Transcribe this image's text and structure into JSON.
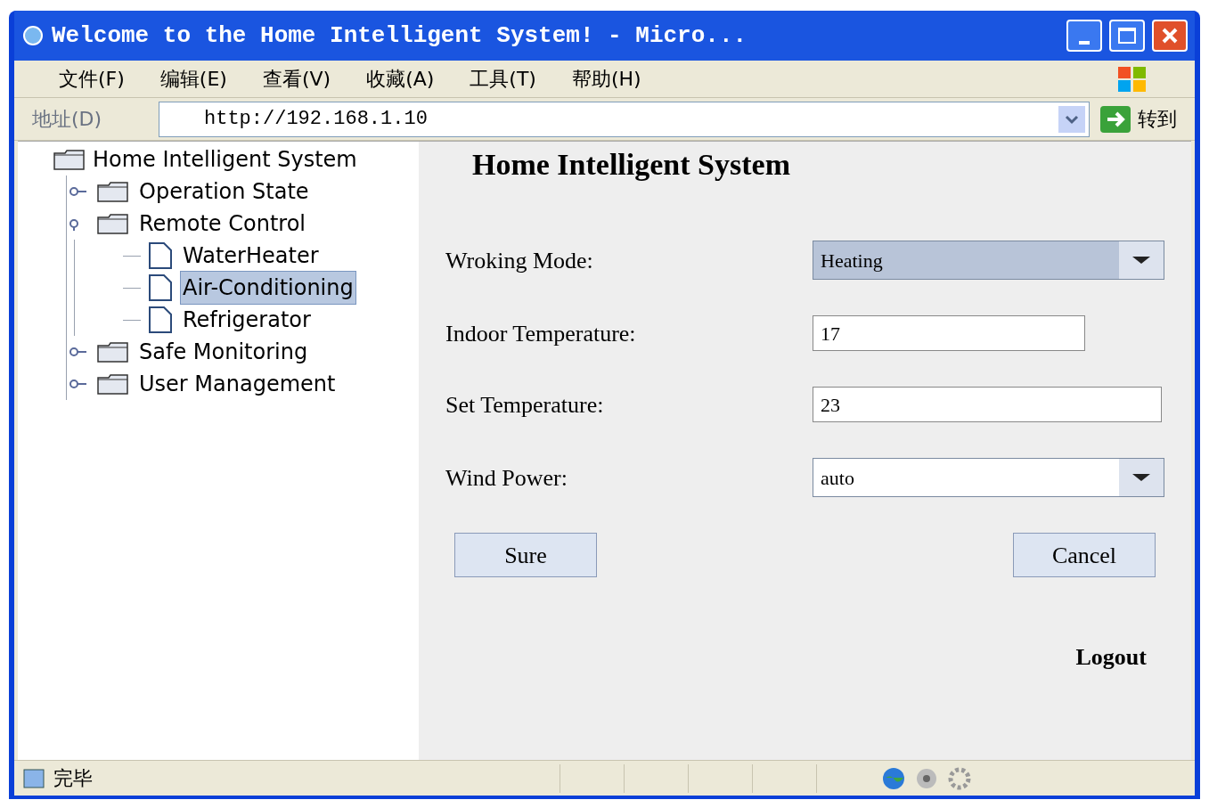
{
  "window": {
    "title": "Welcome to the Home Intelligent System! - Micro..."
  },
  "menu": [
    "文件(F)",
    "编辑(E)",
    "查看(V)",
    "收藏(A)",
    "工具(T)",
    "帮助(H)"
  ],
  "address_bar": {
    "label": "地址(D)",
    "value": "http://192.168.1.10",
    "go": "转到"
  },
  "tree": {
    "label": "Home Intelligent System",
    "children": [
      {
        "label": "Operation State",
        "kind": "folder",
        "expanded": false,
        "selected": false
      },
      {
        "label": "Remote Control",
        "kind": "folder",
        "expanded": true,
        "selected": false,
        "children": [
          {
            "label": "WaterHeater",
            "kind": "file",
            "selected": false
          },
          {
            "label": "Air-Conditioning",
            "kind": "file",
            "selected": true
          },
          {
            "label": "Refrigerator",
            "kind": "file",
            "selected": false
          }
        ]
      },
      {
        "label": "Safe Monitoring",
        "kind": "folder",
        "expanded": false,
        "selected": false
      },
      {
        "label": "User Management",
        "kind": "folder",
        "expanded": false,
        "selected": false
      }
    ]
  },
  "form": {
    "heading": "Home Intelligent System",
    "fields": [
      {
        "label": "Wroking Mode:",
        "kind": "select",
        "value": "Heating",
        "highlighted": true
      },
      {
        "label": "Indoor Temperature:",
        "kind": "text",
        "value": "17"
      },
      {
        "label": "Set Temperature:",
        "kind": "text",
        "value": "23"
      },
      {
        "label": "Wind Power:",
        "kind": "select",
        "value": "auto",
        "highlighted": false
      }
    ],
    "buttons": [
      "Sure",
      "Cancel"
    ],
    "logout": "Logout"
  },
  "status_bar": {
    "text": "完毕"
  }
}
